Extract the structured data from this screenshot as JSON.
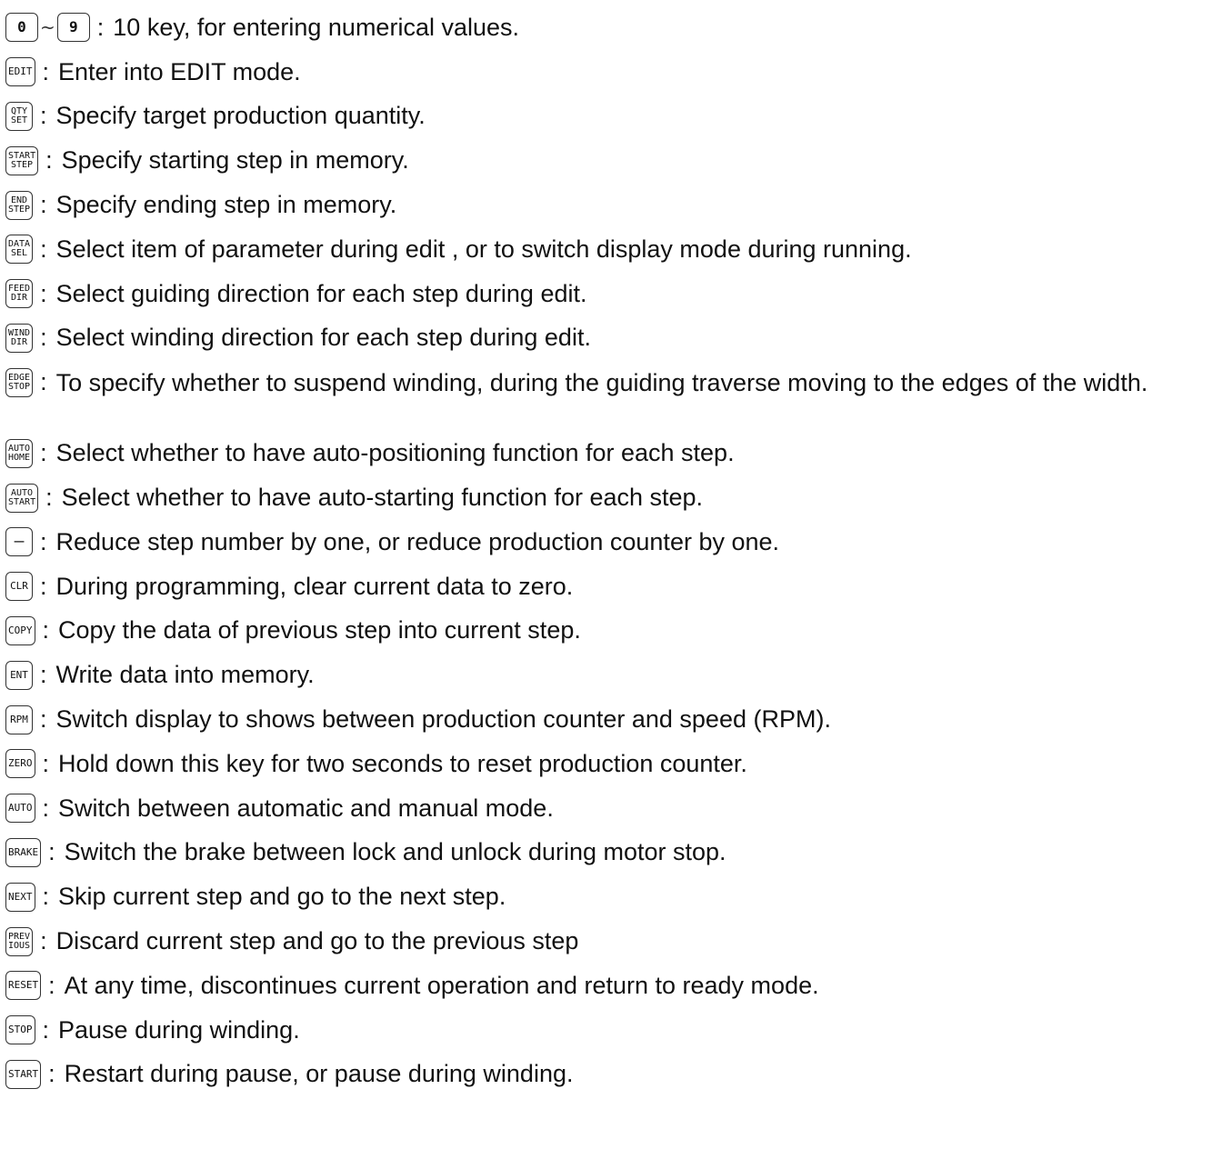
{
  "rows": [
    {
      "key_from": "0",
      "key_to": "9",
      "tilde": "~",
      "colon": ":",
      "text": "10 key, for entering numerical values."
    },
    {
      "key": [
        "EDIT"
      ],
      "colon": ":",
      "text": "Enter into EDIT mode."
    },
    {
      "key": [
        "QTY",
        "SET"
      ],
      "colon": ":",
      "text": "Specify target production quantity."
    },
    {
      "key": [
        "START",
        "STEP"
      ],
      "colon": ":",
      "text": "Specify starting step in memory."
    },
    {
      "key": [
        "END",
        "STEP"
      ],
      "colon": ":",
      "text": "Specify ending step in memory."
    },
    {
      "key": [
        "DATA",
        "SEL"
      ],
      "colon": ":",
      "text": "Select item of parameter during edit , or to switch display mode during running."
    },
    {
      "key": [
        "FEED",
        "DIR"
      ],
      "colon": ":",
      "text": "Select guiding direction for each step during edit."
    },
    {
      "key": [
        "WIND",
        "DIR"
      ],
      "colon": ":",
      "text": "Select winding direction for each step during edit."
    },
    {
      "key": [
        "EDGE",
        "STOP"
      ],
      "colon": ":",
      "text": "To specify whether to suspend winding, during the guiding traverse moving to the edges of the width."
    },
    {
      "key": [
        "AUTO",
        "HOME"
      ],
      "colon": ":",
      "text": "Select whether to have auto-positioning function for each step."
    },
    {
      "key": [
        "AUTO",
        "START"
      ],
      "colon": ":",
      "text": "Select whether to have auto-starting function for each step."
    },
    {
      "key": [
        "—"
      ],
      "colon": ":",
      "text": "Reduce step number by one, or reduce production counter by one."
    },
    {
      "key": [
        "CLR"
      ],
      "colon": ":",
      "text": "During programming, clear current data to zero."
    },
    {
      "key": [
        "COPY"
      ],
      "colon": ":",
      "text": "Copy the data of previous step into current step."
    },
    {
      "key": [
        "ENT"
      ],
      "colon": ":",
      "text": "Write data into memory."
    },
    {
      "key": [
        "RPM"
      ],
      "colon": ":",
      "text": "Switch display to shows between production counter and speed (RPM)."
    },
    {
      "key": [
        "ZERO"
      ],
      "colon": ":",
      "text": "Hold down this key for two seconds to reset production counter."
    },
    {
      "key": [
        "AUTO"
      ],
      "colon": ":",
      "text": "Switch between automatic and manual mode."
    },
    {
      "key": [
        "BRAKE"
      ],
      "colon": ":",
      "text": "Switch the brake between lock and unlock during motor stop."
    },
    {
      "key": [
        "NEXT"
      ],
      "colon": ":",
      "text": "Skip current step and go to the next step."
    },
    {
      "key": [
        "PREV",
        "IOUS"
      ],
      "colon": ":",
      "text": "Discard current step and go to the previous step"
    },
    {
      "key": [
        "RESET"
      ],
      "colon": ":",
      "text": "At any time, discontinues current operation and return to ready mode."
    },
    {
      "key": [
        "STOP"
      ],
      "colon": ":",
      "text": "Pause during winding."
    },
    {
      "key": [
        "START"
      ],
      "colon": ":",
      "text": "Restart during pause, or pause during winding."
    }
  ]
}
